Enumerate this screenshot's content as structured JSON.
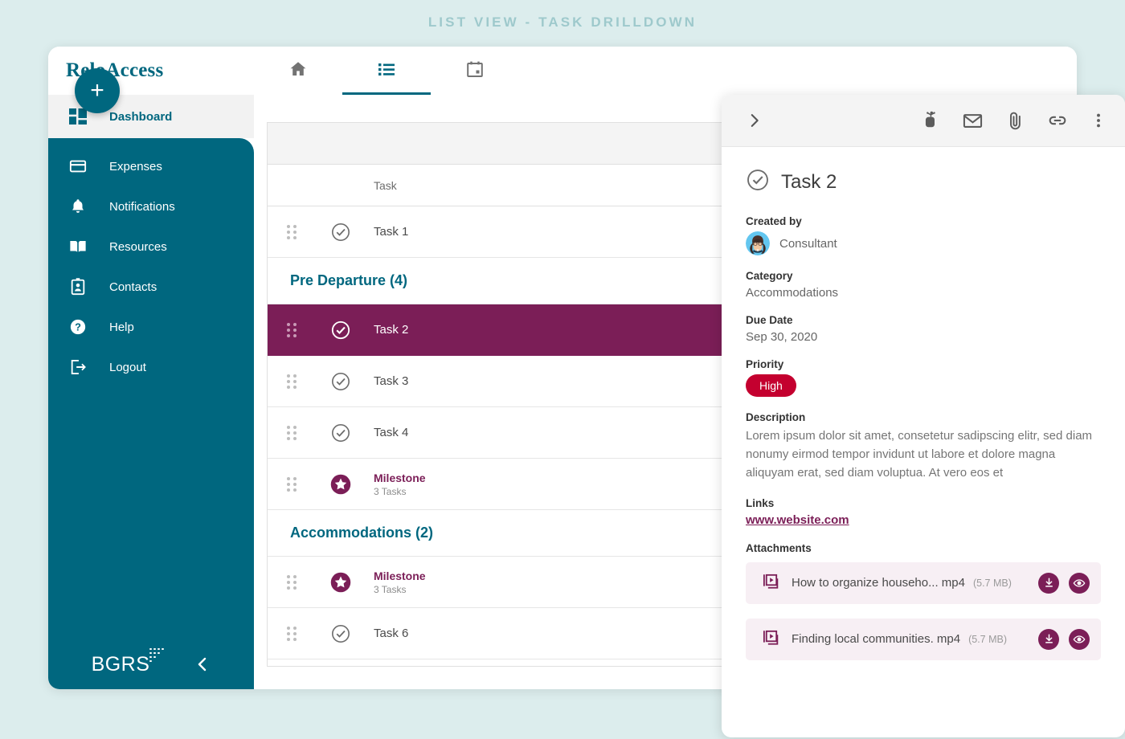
{
  "caption": "List View - Task Drilldown",
  "app": {
    "brand": "ReloAccess",
    "nav_tabs": [
      {
        "name": "home",
        "label": "Home",
        "active": false
      },
      {
        "name": "list",
        "label": "List",
        "active": true
      },
      {
        "name": "calendar",
        "label": "Calendar",
        "active": false
      }
    ]
  },
  "sidebar": {
    "dashboard": {
      "label": "Dashboard",
      "icon": "grid-icon"
    },
    "items": [
      {
        "label": "Expenses",
        "icon": "card-icon"
      },
      {
        "label": "Notifications",
        "icon": "bell-icon"
      },
      {
        "label": "Resources",
        "icon": "book-icon"
      },
      {
        "label": "Contacts",
        "icon": "contact-card-icon"
      },
      {
        "label": "Help",
        "icon": "question-circle-icon"
      },
      {
        "label": "Logout",
        "icon": "logout-icon"
      }
    ],
    "footer": {
      "logo": "BGRS",
      "collapse_icon": "chevron-left-icon"
    }
  },
  "list": {
    "add_button_label": "+",
    "column_header": "Task",
    "rows": [
      {
        "type": "task",
        "name": "Task 1",
        "selected": false
      },
      {
        "type": "group",
        "name": "Pre Departure (4)"
      },
      {
        "type": "task",
        "name": "Task 2",
        "selected": true
      },
      {
        "type": "task",
        "name": "Task 3",
        "selected": false
      },
      {
        "type": "task",
        "name": "Task 4",
        "selected": false
      },
      {
        "type": "milestone",
        "name": "Milestone",
        "sub": "3 Tasks"
      },
      {
        "type": "group",
        "name": "Accommodations (2)"
      },
      {
        "type": "milestone",
        "name": "Milestone",
        "sub": "3 Tasks"
      },
      {
        "type": "task",
        "name": "Task 6",
        "selected": false
      }
    ]
  },
  "detail": {
    "collapse_icon": "chevron-right-icon",
    "actions": [
      {
        "name": "reminder-icon"
      },
      {
        "name": "mail-icon"
      },
      {
        "name": "paperclip-icon"
      },
      {
        "name": "link-icon"
      },
      {
        "name": "more-vertical-icon"
      }
    ],
    "title": "Task 2",
    "created_by_label": "Created by",
    "created_by": "Consultant",
    "category_label": "Category",
    "category": "Accommodations",
    "due_date_label": "Due Date",
    "due_date": "Sep 30, 2020",
    "priority_label": "Priority",
    "priority": "High",
    "priority_color": "#c4002f",
    "description_label": "Description",
    "description": "Lorem ipsum dolor sit amet, consetetur sadipscing elitr, sed diam nonumy eirmod tempor invidunt ut labore et dolore magna aliquyam erat, sed diam voluptua. At vero eos et",
    "links_label": "Links",
    "link_text": "www.website.com",
    "attachments_label": "Attachments",
    "attachments": [
      {
        "name": "How to organize househo... mp4",
        "size": "(5.7 MB)"
      },
      {
        "name": "Finding local communities. mp4",
        "size": "(5.7 MB)"
      }
    ]
  },
  "colors": {
    "teal": "#00677f",
    "purple": "#7b1e57",
    "red": "#c4002f",
    "page_bg": "#dceded"
  }
}
